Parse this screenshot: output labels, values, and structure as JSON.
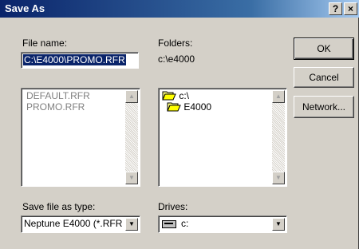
{
  "window": {
    "title": "Save As",
    "help_glyph": "?",
    "close_glyph": "×"
  },
  "file_name": {
    "label": "File name:",
    "value": "C:\\E4000\\PROMO.RFR",
    "files": [
      "DEFAULT.RFR",
      "PROMO.RFR"
    ]
  },
  "folders": {
    "label": "Folders:",
    "current_path": "c:\\e4000",
    "items": [
      {
        "name": "c:\\",
        "icon": "open-folder-icon"
      },
      {
        "name": "E4000",
        "icon": "open-folder-icon"
      }
    ]
  },
  "buttons": {
    "ok": "OK",
    "cancel": "Cancel",
    "network": "Network..."
  },
  "save_type": {
    "label": "Save file as type:",
    "value": "Neptune E4000  (*.RFR"
  },
  "drives": {
    "label": "Drives:",
    "value": "c:",
    "icon": "drive-icon"
  },
  "colors": {
    "title_bar": "#0a246a",
    "selection": "#0a246a",
    "dialog_face": "#d4d0c8",
    "disabled_text": "#808080"
  }
}
